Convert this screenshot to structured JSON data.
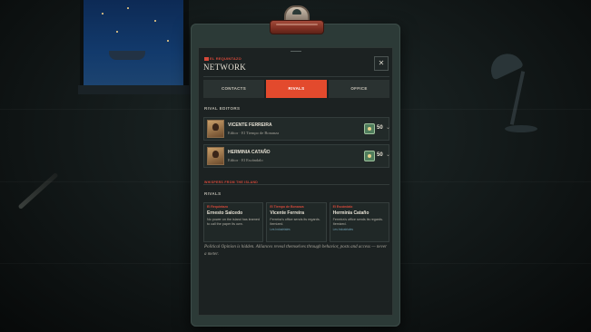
{
  "header": {
    "brand": "EL REQUINTAZO",
    "title": "NETWORK",
    "close_label": "✕"
  },
  "tabs": [
    {
      "label": "CONTACTS",
      "active": false
    },
    {
      "label": "RIVALS",
      "active": true
    },
    {
      "label": "OFFICE",
      "active": false
    }
  ],
  "rival_editors": {
    "section_label": "RIVAL EDITORS",
    "items": [
      {
        "name": "VICENTE FERREIRA",
        "subtitle": "Editor · El Tiempo de Bonanza",
        "value": "50",
        "icon": "relationship-icon"
      },
      {
        "name": "HERMINIA CATAÑO",
        "subtitle": "Editor · El Escándalo",
        "value": "50",
        "icon": "relationship-icon"
      }
    ]
  },
  "whispers_label": "WHISPERS FROM THE ISLAND",
  "rivals": {
    "section_label": "RIVALS",
    "cards": [
      {
        "paper": "El Requintazo",
        "name": "Ernesto Salcedo",
        "text": "No power on the island has learned to call the paper its own.",
        "link": ""
      },
      {
        "paper": "El Tiempo de Bonanza",
        "name": "Vicente Ferreira",
        "text": "Ferreira's office sends its regards. Itemized.",
        "link": "Les Industriales"
      },
      {
        "paper": "El Escándalo",
        "name": "Herminia Cataño",
        "text": "Ferreira's office sends its regards. Itemized.",
        "link": "Les Industriales"
      }
    ]
  },
  "footnote": "Political Opinion is hidden. Alliances reveal themselves through behavior, posts and access — never a meter.",
  "colors": {
    "accent": "#e34a2d",
    "paper_bg": "#1c2222",
    "clipboard": "#2c3a37",
    "clip": "#7e2f22"
  }
}
